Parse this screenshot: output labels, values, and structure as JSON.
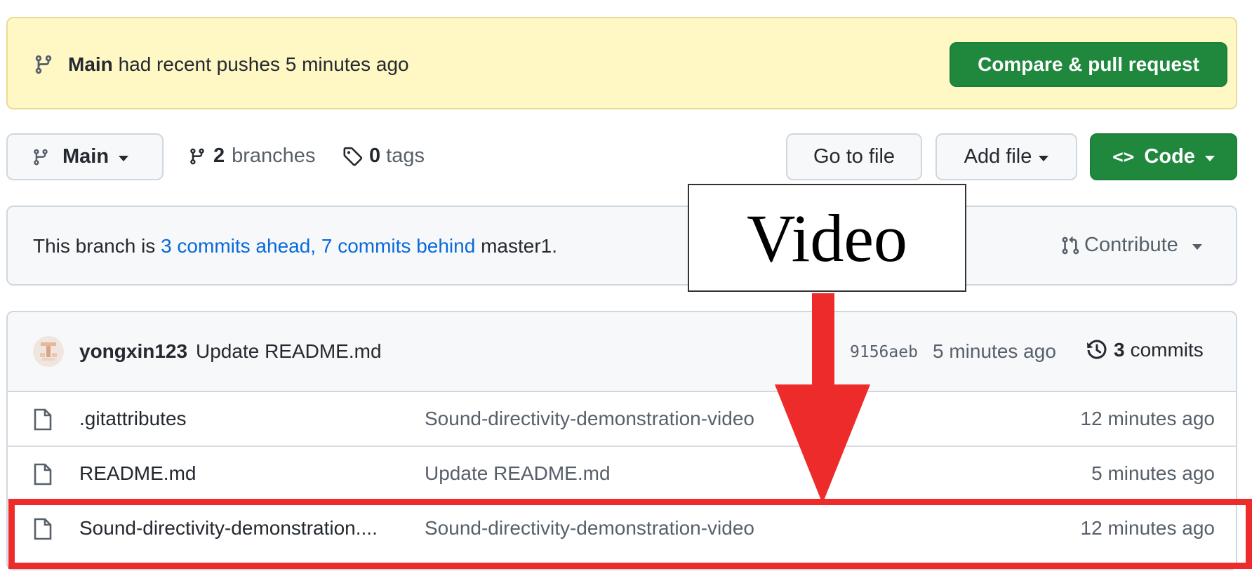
{
  "banner": {
    "branch": "Main",
    "text": "had recent pushes 5 minutes ago",
    "button_label": "Compare & pull request"
  },
  "toolbar": {
    "branch_label": "Main",
    "branches_count": "2",
    "branches_label": "branches",
    "tags_count": "0",
    "tags_label": "tags",
    "go_to_file": "Go to file",
    "add_file": "Add file",
    "code": "Code"
  },
  "status": {
    "prefix": "This branch is",
    "ahead": "3 commits ahead,",
    "behind": "7 commits behind",
    "base": "master1.",
    "contribute": "Contribute"
  },
  "latest_commit": {
    "author": "yongxin123",
    "message": "Update README.md",
    "sha": "9156aeb",
    "time": "5 minutes ago",
    "commits_count": "3",
    "commits_label": "commits"
  },
  "files": [
    {
      "name": ".gitattributes",
      "message": "Sound-directivity-demonstration-video",
      "time": "12 minutes ago"
    },
    {
      "name": "README.md",
      "message": "Update README.md",
      "time": "5 minutes ago"
    },
    {
      "name": "Sound-directivity-demonstration....",
      "message": "Sound-directivity-demonstration-video",
      "time": "12 minutes ago"
    }
  ],
  "annotation": {
    "label": "Video",
    "color": "#ee2b2b"
  },
  "colors": {
    "banner_bg": "#fff8c5",
    "primary_green": "#1f883d",
    "link_blue": "#0969da"
  },
  "icons": [
    "git-branch-icon",
    "tag-icon",
    "code-icon",
    "pull-request-icon",
    "history-icon",
    "file-icon",
    "avatar"
  ]
}
